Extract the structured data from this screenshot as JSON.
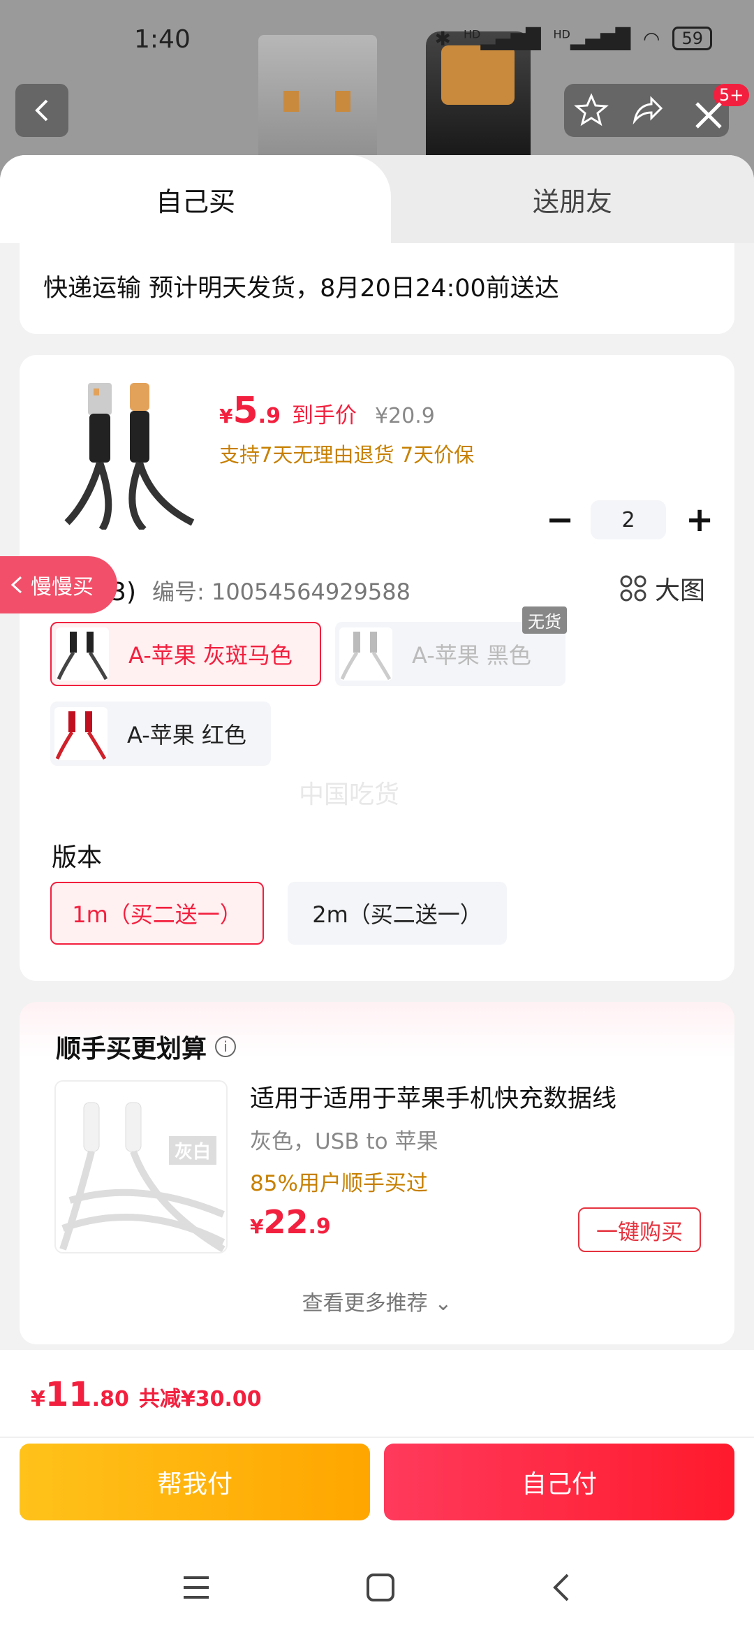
{
  "status_bar": {
    "time": "1:40",
    "hd1": "HD",
    "hd2": "HD",
    "battery": "59"
  },
  "header": {
    "badge": "5+"
  },
  "tabs": {
    "self": "自己买",
    "friend": "送朋友"
  },
  "shipping": {
    "text": "快递运输 预计明天发货，8月20日24:00前送达"
  },
  "product": {
    "yen": "¥",
    "price_int": "5",
    "price_dec": ".9",
    "price_label": "到手价",
    "original_price": "¥20.9",
    "promise": "支持7天无理由退货 7天价保",
    "quantity": "2",
    "minus": "−",
    "plus": "+"
  },
  "color": {
    "label": "颜色(3)",
    "sku": "编号: 10054564929588",
    "big_image": "大图",
    "options": [
      {
        "label": "A-苹果 灰斑马色",
        "state": "selected"
      },
      {
        "label": "A-苹果 黑色",
        "state": "disabled",
        "tag": "无货"
      },
      {
        "label": "A-苹果 红色",
        "state": "normal"
      }
    ]
  },
  "watermark": "中国吃货",
  "version": {
    "title": "版本",
    "options": [
      {
        "label": "1m（买二送一）",
        "state": "selected"
      },
      {
        "label": "2m（买二送一）",
        "state": "normal"
      }
    ]
  },
  "slow_buy": "慢慢买",
  "recommend": {
    "title": "顺手买更划算",
    "tag": "灰白",
    "name": "适用于适用于苹果手机快充数据线",
    "spec": "灰色，USB to 苹果",
    "stat": "85%用户顺手买过",
    "yen": "¥",
    "price_int": "22",
    "price_dec": ".9",
    "buy_button": "一键购买",
    "more": "查看更多推荐 ⌄"
  },
  "footer": {
    "yen": "¥",
    "total_int": "11",
    "total_dec": ".80",
    "saving": "共减¥30.00",
    "help_pay": "帮我付",
    "self_pay": "自己付"
  },
  "colors": {
    "accent": "#f2203e",
    "gold": "#c78000",
    "help_btn": "#ffb300"
  }
}
